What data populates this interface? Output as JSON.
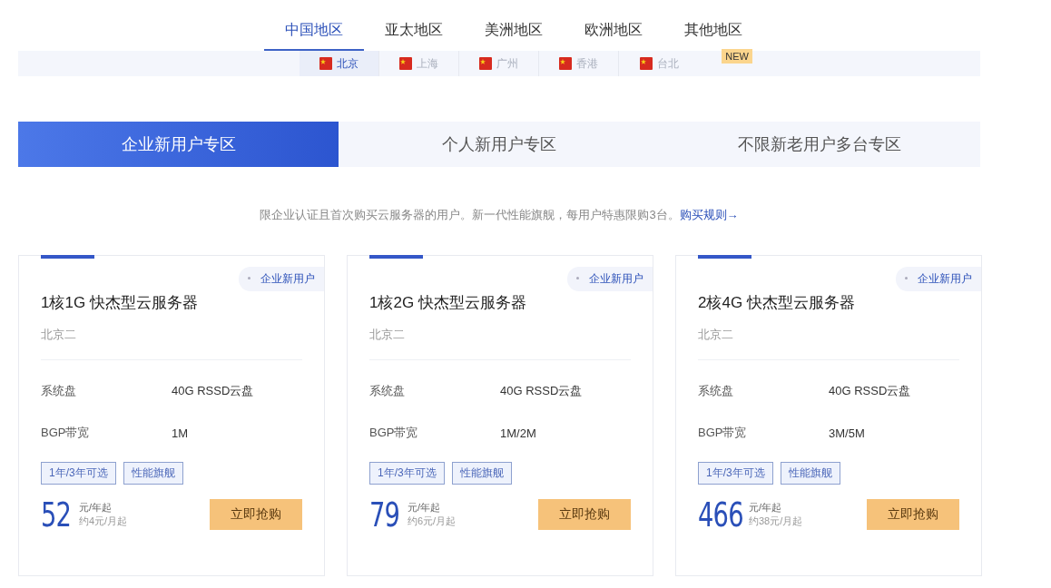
{
  "regions": [
    {
      "label": "中国地区",
      "selected": true
    },
    {
      "label": "亚太地区",
      "selected": false
    },
    {
      "label": "美洲地区",
      "selected": false
    },
    {
      "label": "欧洲地区",
      "selected": false
    },
    {
      "label": "其他地区",
      "selected": false,
      "badge": "NEW"
    }
  ],
  "cities": [
    {
      "label": "北京",
      "selected": true
    },
    {
      "label": "上海",
      "selected": false
    },
    {
      "label": "广州",
      "selected": false
    },
    {
      "label": "香港",
      "selected": false
    },
    {
      "label": "台北",
      "selected": false
    }
  ],
  "segments": [
    {
      "label": "企业新用户专区",
      "selected": true
    },
    {
      "label": "个人新用户专区",
      "selected": false
    },
    {
      "label": "不限新老用户多台专区",
      "selected": false
    }
  ],
  "notice": {
    "text": "限企业认证且首次购买云服务器的用户。新一代性能旗舰，每用户特惠限购3台。",
    "link": "购买规则→"
  },
  "products": [
    {
      "tag": "企业新用户",
      "title": "1核1G 快杰型云服务器",
      "location": "北京二",
      "specs": [
        {
          "label": "系统盘",
          "value": "40G RSSD云盘"
        },
        {
          "label": "BGP带宽",
          "value": "1M"
        }
      ],
      "features": [
        "1年/3年可选",
        "性能旗舰"
      ],
      "price": "52",
      "unit": "元/年起",
      "monthly": "约4元/月起",
      "button": "立即抢购"
    },
    {
      "tag": "企业新用户",
      "title": "1核2G 快杰型云服务器",
      "location": "北京二",
      "specs": [
        {
          "label": "系统盘",
          "value": "40G RSSD云盘"
        },
        {
          "label": "BGP带宽",
          "value": "1M/2M"
        }
      ],
      "features": [
        "1年/3年可选",
        "性能旗舰"
      ],
      "price": "79",
      "unit": "元/年起",
      "monthly": "约6元/月起",
      "button": "立即抢购"
    },
    {
      "tag": "企业新用户",
      "title": "2核4G 快杰型云服务器",
      "location": "北京二",
      "specs": [
        {
          "label": "系统盘",
          "value": "40G RSSD云盘"
        },
        {
          "label": "BGP带宽",
          "value": "3M/5M"
        }
      ],
      "features": [
        "1年/3年可选",
        "性能旗舰"
      ],
      "price": "466",
      "unit": "元/年起",
      "monthly": "约38元/月起",
      "button": "立即抢购"
    }
  ]
}
